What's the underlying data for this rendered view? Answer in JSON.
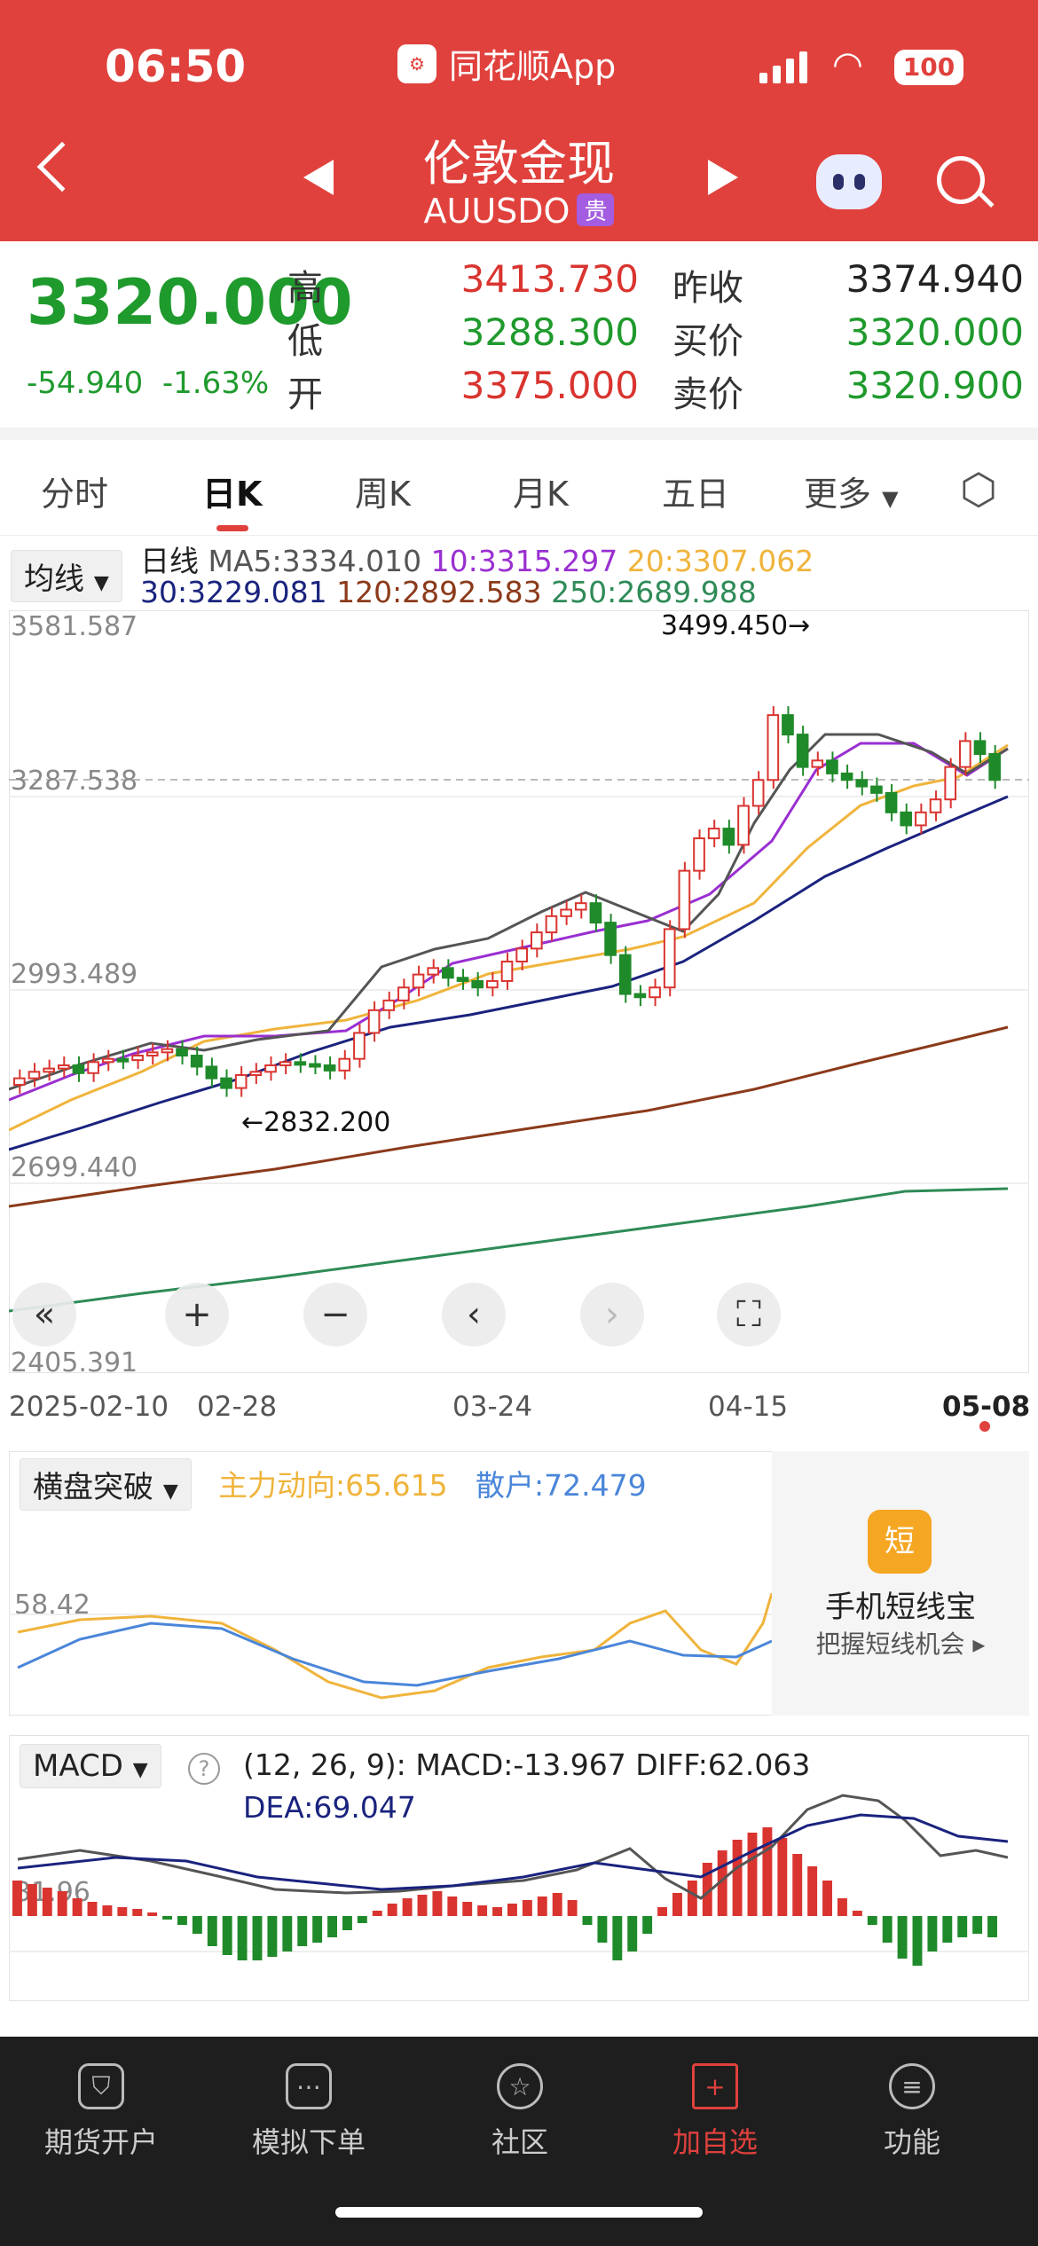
{
  "status_bar": {
    "time": "06:50",
    "app_name": "同花顺App",
    "battery": "100"
  },
  "header": {
    "title": "伦敦金现",
    "code": "AUUSDO",
    "badge": "贵"
  },
  "quote": {
    "price": "3320.000",
    "change": "-54.940",
    "change_pct": "-1.63%",
    "high_label": "高",
    "high": "3413.730",
    "low_label": "低",
    "low": "3288.300",
    "open_label": "开",
    "open": "3375.000",
    "prev_close_label": "昨收",
    "prev_close": "3374.940",
    "bid_label": "买价",
    "bid": "3320.000",
    "ask_label": "卖价",
    "ask": "3320.900"
  },
  "tabs": [
    "分时",
    "日K",
    "周K",
    "月K",
    "五日",
    "更多"
  ],
  "active_tab": "日K",
  "ma_legend": {
    "selector": "均线",
    "label": "日线",
    "ma5": "MA5:3334.010",
    "ma10": "10:3315.297",
    "ma20": "20:3307.062",
    "ma30": "30:3229.081",
    "ma120": "120:2892.583",
    "ma250": "250:2689.988"
  },
  "colors": {
    "ma5": "#555555",
    "ma10": "#9a2fd1",
    "ma20": "#f0b43c",
    "ma30": "#1a237e",
    "ma120": "#8b3a1a",
    "ma250": "#2e8b57",
    "up": "#d9342f",
    "down": "#1f8a2a"
  },
  "kline": {
    "axis_ticks": [
      "3581.587",
      "3287.538",
      "2993.489",
      "2699.440",
      "2405.391"
    ],
    "ymin": 2405.391,
    "ymax": 3581.587,
    "current_price": 3320.0,
    "high_annotation": "3499.450→",
    "low_annotation": "←2832.200",
    "dates": [
      "2025-02-10",
      "02-28",
      "03-24",
      "04-15",
      "05-08"
    ]
  },
  "controls": [
    "double-chevron-left-icon",
    "zoom-in-icon",
    "zoom-out-icon",
    "chevron-left-icon",
    "chevron-right-icon",
    "fullscreen-icon"
  ],
  "indicator1": {
    "selector": "横盘突破",
    "main": "主力动向:65.615",
    "retail": "散户:72.479",
    "axis_tick": "58.42"
  },
  "promo": {
    "title": "手机短线宝",
    "subtitle": "把握短线机会",
    "icon_text": "短"
  },
  "macd": {
    "selector": "MACD",
    "params": "(12, 26, 9):",
    "macd": "MACD:-13.967",
    "diff": "DIFF:62.063",
    "dea": "DEA:69.047",
    "axis_tick": "31.96"
  },
  "bottom_nav": [
    {
      "label": "期货开户",
      "icon": "person-icon"
    },
    {
      "label": "模拟下单",
      "icon": "document-icon"
    },
    {
      "label": "社区",
      "icon": "community-icon"
    },
    {
      "label": "加自选",
      "icon": "add-icon"
    },
    {
      "label": "功能",
      "icon": "menu-icon"
    }
  ]
}
